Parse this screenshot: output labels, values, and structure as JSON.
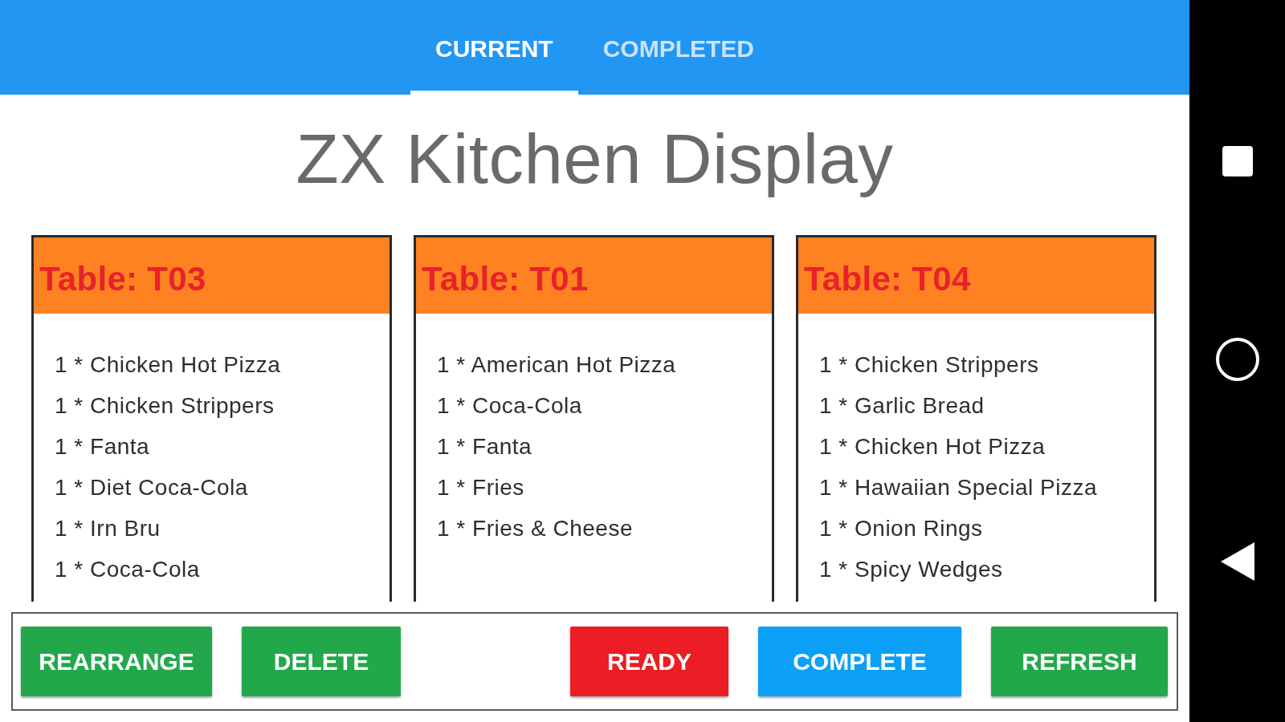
{
  "tabs": [
    {
      "label": "CURRENT",
      "selected": true
    },
    {
      "label": "COMPLETED",
      "selected": false
    }
  ],
  "title": "ZX Kitchen Display",
  "orders": [
    {
      "table": "Table: T03",
      "items": [
        "1 * Chicken Hot Pizza",
        "1 * Chicken Strippers",
        "1 * Fanta",
        "1 * Diet Coca-Cola",
        "1 * Irn Bru",
        "1 * Coca-Cola"
      ]
    },
    {
      "table": "Table: T01",
      "items": [
        "1 * American Hot Pizza",
        "1 * Coca-Cola",
        "1 * Fanta",
        "1 * Fries",
        "1 * Fries & Cheese"
      ]
    },
    {
      "table": "Table: T04",
      "items": [
        "1 * Chicken Strippers",
        "1 * Garlic Bread",
        "1 * Chicken Hot Pizza",
        "1 * Hawaiian Special Pizza",
        "1 * Onion Rings",
        "1 * Spicy Wedges"
      ]
    }
  ],
  "actions": [
    {
      "label": "REARRANGE",
      "color": "#22a84b"
    },
    {
      "label": "DELETE",
      "color": "#22a84b"
    },
    {
      "label": "READY",
      "color": "#ec1d24"
    },
    {
      "label": "COMPLETE",
      "color": "#0ba0f6"
    },
    {
      "label": "REFRESH",
      "color": "#22a84b"
    }
  ]
}
